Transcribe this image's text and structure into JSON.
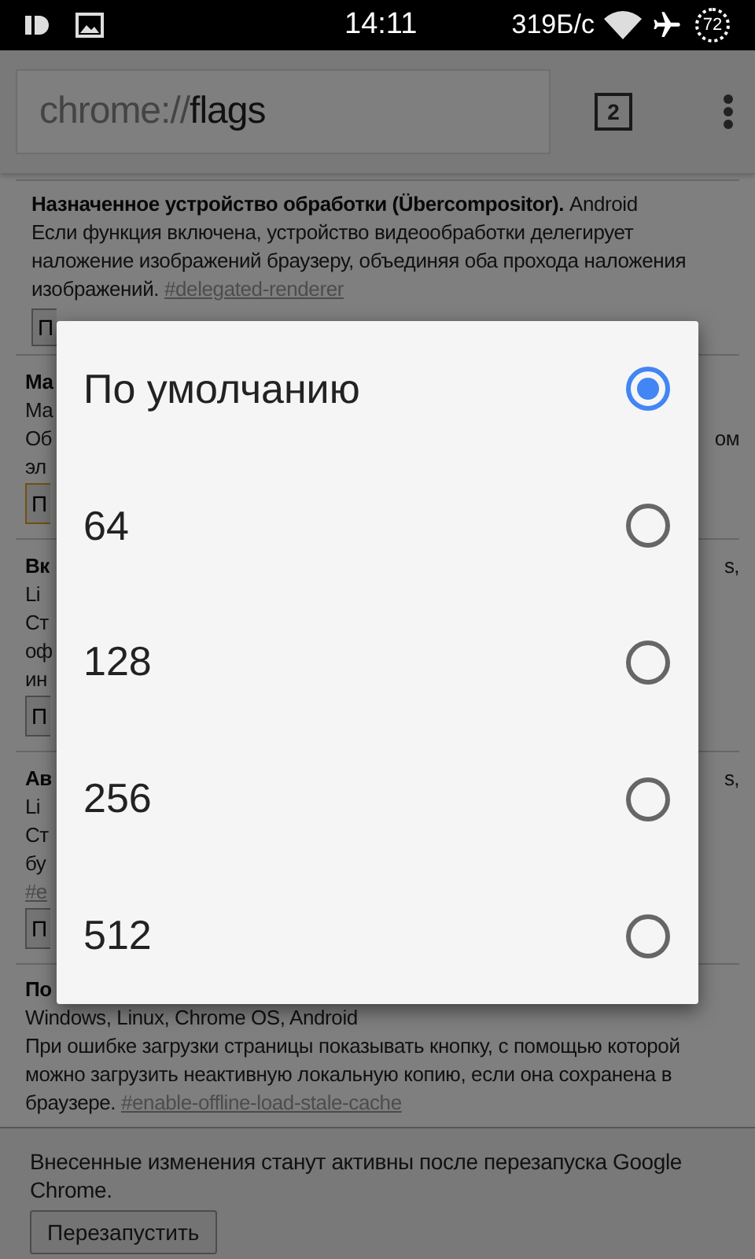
{
  "status_bar": {
    "time": "14:11",
    "speed": "319Б/с",
    "battery": "72"
  },
  "toolbar": {
    "url_scheme": "chrome://",
    "url_host": "flags",
    "tab_count": "2"
  },
  "sections": [
    {
      "kind": "full",
      "title": "Назначенное устройство обработки (Übercompositor).",
      "platforms": "Android",
      "description": "Если функция включена, устройство видеообработки делегирует наложение изображений браузеру, объединяя оба прохода наложения изображений.",
      "flag": "#delegated-renderer",
      "button": "П",
      "focused": false
    },
    {
      "kind": "fragment",
      "lines": [
        {
          "kind": "title",
          "left": "Ма"
        },
        {
          "kind": "text",
          "left": "Ма"
        },
        {
          "kind": "text",
          "left": "Об",
          "right": "ом"
        },
        {
          "kind": "text",
          "left": "эл"
        },
        {
          "kind": "button",
          "left": "П"
        }
      ],
      "focused": true
    },
    {
      "kind": "fragment",
      "lines": [
        {
          "kind": "title",
          "left": "Вк",
          "right": "s,"
        },
        {
          "kind": "text",
          "left": "Li"
        },
        {
          "kind": "text",
          "left": "Ст"
        },
        {
          "kind": "text",
          "left": "оф"
        },
        {
          "kind": "text",
          "left": "ин"
        },
        {
          "kind": "button",
          "left": "П"
        }
      ],
      "focused": false
    },
    {
      "kind": "fragment",
      "lines": [
        {
          "kind": "title",
          "left": "Ав",
          "right": "s,"
        },
        {
          "kind": "text",
          "left": "Li"
        },
        {
          "kind": "text",
          "left": "Ст"
        },
        {
          "kind": "text",
          "left": "бу"
        },
        {
          "kind": "flag",
          "left": "#e"
        },
        {
          "kind": "button",
          "left": "П"
        }
      ],
      "focused": false
    },
    {
      "kind": "tail",
      "title": "По",
      "platforms": "Windows, Linux, Chrome OS, Android",
      "description": "При ошибке загрузки страницы показывать кнопку, с помощью которой можно загрузить неактивную локальную копию, если она сохранена в браузере.",
      "flag": "#enable-offline-load-stale-cache"
    }
  ],
  "restart_bar": {
    "message": "Внесенные изменения станут активны после перезапуска Google Chrome.",
    "button": "Перезапустить"
  },
  "dialog": {
    "options": [
      {
        "label": "По умолчанию",
        "selected": true
      },
      {
        "label": "64",
        "selected": false
      },
      {
        "label": "128",
        "selected": false
      },
      {
        "label": "256",
        "selected": false
      },
      {
        "label": "512",
        "selected": false
      }
    ]
  }
}
